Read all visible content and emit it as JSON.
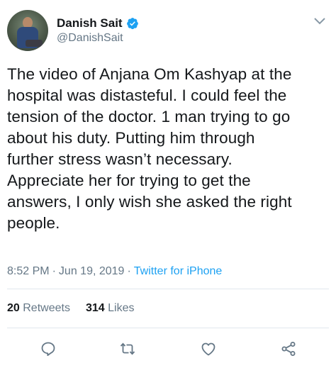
{
  "user": {
    "display_name": "Danish Sait",
    "handle": "@DanishSait",
    "verified": true
  },
  "tweet": {
    "lines": [
      "The video of Anjana Om Kashyap at the",
      "hospital was distasteful. I could feel the",
      "tension of the doctor. 1 man trying to go",
      "about his duty. Putting him through",
      "further stress wasn’t necessary.",
      "Appreciate her for trying to get the",
      "answers, I only wish she asked the right",
      "people."
    ]
  },
  "meta": {
    "time": "8:52 PM",
    "separator": "·",
    "date": "Jun 19, 2019",
    "source": "Twitter for iPhone"
  },
  "stats": {
    "retweets_count": "20",
    "retweets_label": "Retweets",
    "likes_count": "314",
    "likes_label": "Likes"
  },
  "actions": {
    "reply_icon": "reply-icon",
    "retweet_icon": "retweet-icon",
    "like_icon": "heart-icon",
    "share_icon": "share-icon"
  },
  "colors": {
    "text": "#14171a",
    "secondary": "#657786",
    "link": "#1da1f2",
    "divider": "#e1e8ed"
  }
}
